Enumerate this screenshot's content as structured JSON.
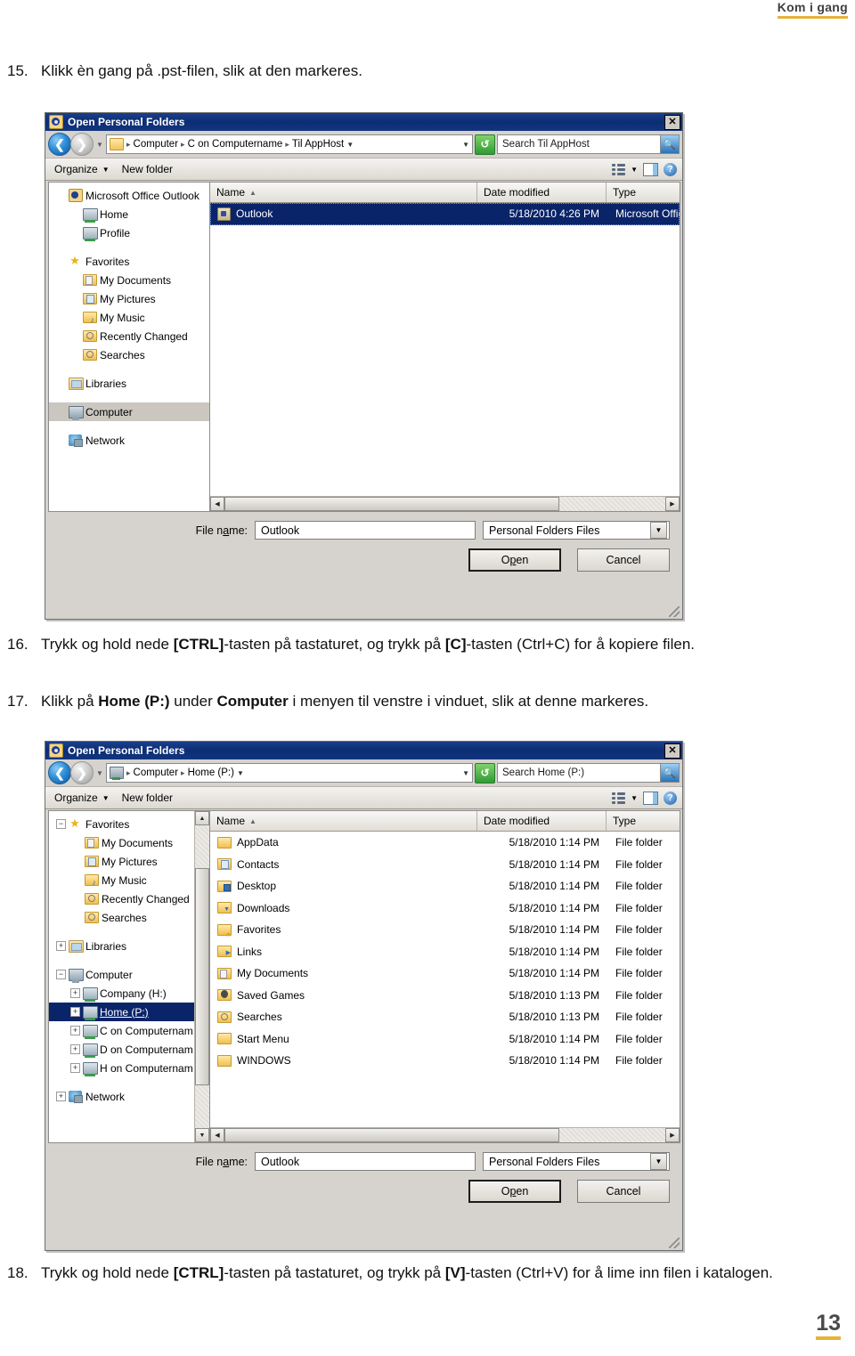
{
  "header": {
    "title": "Kom i gang"
  },
  "page_number": "13",
  "steps": {
    "s15": {
      "num": "15.",
      "text_a": "Klikk èn gang på .pst-filen, slik at den markeres."
    },
    "s16": {
      "num": "16.",
      "text_a": "Trykk og hold nede ",
      "bold_a": "[CTRL]",
      "text_b": "-tasten på tastaturet,  og trykk på ",
      "bold_b": "[C]",
      "text_c": "-tasten (Ctrl+C) for å kopiere filen."
    },
    "s17": {
      "num": "17.",
      "text_a": "Klikk på ",
      "bold_a": "Home (P:)",
      "text_b": " under ",
      "bold_b": "Computer",
      "text_c": " i menyen til venstre i vinduet, slik at denne markeres."
    },
    "s18": {
      "num": "18.",
      "text_a": "Trykk og hold nede ",
      "bold_a": "[CTRL]",
      "text_b": "-tasten på tastaturet,  og trykk på ",
      "bold_b": "[V]",
      "text_c": "-tasten (Ctrl+V) for å lime inn filen i katalogen."
    }
  },
  "dialog1": {
    "title": "Open Personal Folders",
    "title_icon": "outlook-icon",
    "close_label": "✕",
    "nav": {
      "back_icon": "back-arrow-icon",
      "forward_icon": "forward-arrow-icon",
      "history_caret": "▼",
      "breadcrumbs": [
        "Computer",
        "C on Computername",
        "Til AppHost"
      ],
      "crumb_caret": "▼",
      "path_dropdown_caret": "▼",
      "refresh_icon": "refresh-icon",
      "search_value": "Search Til AppHost",
      "search_icon": "search-icon"
    },
    "toolbar": {
      "organize": "Organize",
      "organize_caret": "▼",
      "new_folder": "New folder",
      "views_icon": "views-list-icon",
      "views_caret": "▼",
      "preview_pane_icon": "preview-pane-icon",
      "help_icon": "help-icon",
      "help_glyph": "?"
    },
    "tree": [
      {
        "label": "Microsoft Office Outlook",
        "icon": "outlook-icon",
        "indent": 0,
        "expander": "",
        "state": ""
      },
      {
        "label": "Home",
        "icon": "drive-icon",
        "indent": 1,
        "expander": "",
        "state": ""
      },
      {
        "label": "Profile",
        "icon": "drive-icon",
        "indent": 1,
        "expander": "",
        "state": ""
      },
      {
        "label": "",
        "icon": "",
        "indent": 0,
        "expander": "",
        "state": "spacer"
      },
      {
        "label": "Favorites",
        "icon": "star-icon",
        "indent": 0,
        "expander": "",
        "state": ""
      },
      {
        "label": "My Documents",
        "icon": "folder-documents-icon",
        "indent": 1,
        "expander": "",
        "state": ""
      },
      {
        "label": "My Pictures",
        "icon": "folder-pictures-icon",
        "indent": 1,
        "expander": "",
        "state": ""
      },
      {
        "label": "My Music",
        "icon": "folder-music-icon",
        "indent": 1,
        "expander": "",
        "state": ""
      },
      {
        "label": "Recently Changed",
        "icon": "folder-recent-icon",
        "indent": 1,
        "expander": "",
        "state": ""
      },
      {
        "label": "Searches",
        "icon": "folder-search-icon",
        "indent": 1,
        "expander": "",
        "state": ""
      },
      {
        "label": "",
        "icon": "",
        "indent": 0,
        "expander": "",
        "state": "spacer"
      },
      {
        "label": "Libraries",
        "icon": "library-icon",
        "indent": 0,
        "expander": "",
        "state": ""
      },
      {
        "label": "",
        "icon": "",
        "indent": 0,
        "expander": "",
        "state": "spacer"
      },
      {
        "label": "Computer",
        "icon": "computer-icon",
        "indent": 0,
        "expander": "",
        "state": "selected-gray"
      },
      {
        "label": "",
        "icon": "",
        "indent": 0,
        "expander": "",
        "state": "spacer"
      },
      {
        "label": "Network",
        "icon": "network-icon",
        "indent": 0,
        "expander": "",
        "state": ""
      }
    ],
    "columns": {
      "name": "Name",
      "date": "Date modified",
      "type": "Type",
      "sort_caret": "▲"
    },
    "files": [
      {
        "name": "Outlook",
        "date": "5/18/2010 4:26 PM",
        "type": "Microsoft Office",
        "icon": "pst-file-icon",
        "selected": true
      }
    ],
    "footer": {
      "filename_label_pre": "File n",
      "filename_label_u": "a",
      "filename_label_post": "me:",
      "filename_value": "Outlook",
      "filter_value": "Personal Folders Files",
      "filter_caret": "▼",
      "open_pre": "O",
      "open_u": "p",
      "open_post": "en",
      "cancel": "Cancel"
    }
  },
  "dialog2": {
    "title": "Open Personal Folders",
    "title_icon": "outlook-icon",
    "close_label": "✕",
    "nav": {
      "back_icon": "back-arrow-icon",
      "forward_icon": "forward-arrow-icon",
      "history_caret": "▼",
      "breadcrumbs": [
        "Computer",
        "Home (P:)"
      ],
      "crumb_caret": "▼",
      "path_dropdown_caret": "▼",
      "refresh_icon": "refresh-icon",
      "search_value": "Search Home (P:)",
      "search_icon": "search-icon"
    },
    "toolbar": {
      "organize": "Organize",
      "organize_caret": "▼",
      "new_folder": "New folder",
      "views_icon": "views-list-icon",
      "views_caret": "▼",
      "preview_pane_icon": "preview-pane-icon",
      "help_icon": "help-icon",
      "help_glyph": "?"
    },
    "tree": [
      {
        "label": "Favorites",
        "icon": "star-icon",
        "indent": 0,
        "expander": "−",
        "state": ""
      },
      {
        "label": "My Documents",
        "icon": "folder-documents-icon",
        "indent": 2,
        "expander": "",
        "state": ""
      },
      {
        "label": "My Pictures",
        "icon": "folder-pictures-icon",
        "indent": 2,
        "expander": "",
        "state": ""
      },
      {
        "label": "My Music",
        "icon": "folder-music-icon",
        "indent": 2,
        "expander": "",
        "state": ""
      },
      {
        "label": "Recently Changed",
        "icon": "folder-recent-icon",
        "indent": 2,
        "expander": "",
        "state": ""
      },
      {
        "label": "Searches",
        "icon": "folder-search-icon",
        "indent": 2,
        "expander": "",
        "state": ""
      },
      {
        "label": "",
        "icon": "",
        "indent": 0,
        "expander": "",
        "state": "spacer"
      },
      {
        "label": "Libraries",
        "icon": "library-icon",
        "indent": 0,
        "expander": "+",
        "state": ""
      },
      {
        "label": "",
        "icon": "",
        "indent": 0,
        "expander": "",
        "state": "spacer"
      },
      {
        "label": "Computer",
        "icon": "computer-icon",
        "indent": 0,
        "expander": "−",
        "state": ""
      },
      {
        "label": "Company (H:)",
        "icon": "drive-icon",
        "indent": 1,
        "expander": "+",
        "state": ""
      },
      {
        "label": "Home (P:)",
        "icon": "drive-icon",
        "indent": 1,
        "expander": "+",
        "state": "selected-blue"
      },
      {
        "label": "C on Computernam",
        "icon": "drive-icon",
        "indent": 1,
        "expander": "+",
        "state": ""
      },
      {
        "label": "D on Computernam",
        "icon": "drive-icon",
        "indent": 1,
        "expander": "+",
        "state": ""
      },
      {
        "label": "H on Computernam",
        "icon": "drive-icon",
        "indent": 1,
        "expander": "+",
        "state": ""
      },
      {
        "label": "",
        "icon": "",
        "indent": 0,
        "expander": "",
        "state": "spacer"
      },
      {
        "label": "Network",
        "icon": "network-icon",
        "indent": 0,
        "expander": "+",
        "state": ""
      }
    ],
    "columns": {
      "name": "Name",
      "date": "Date modified",
      "type": "Type",
      "sort_caret": "▲"
    },
    "files": [
      {
        "name": "AppData",
        "date": "5/18/2010 1:14 PM",
        "type": "File folder",
        "icon": "folder-icon",
        "selected": false
      },
      {
        "name": "Contacts",
        "date": "5/18/2010 1:14 PM",
        "type": "File folder",
        "icon": "folder-contacts-icon",
        "selected": false
      },
      {
        "name": "Desktop",
        "date": "5/18/2010 1:14 PM",
        "type": "File folder",
        "icon": "folder-desktop-icon",
        "selected": false
      },
      {
        "name": "Downloads",
        "date": "5/18/2010 1:14 PM",
        "type": "File folder",
        "icon": "folder-downloads-icon",
        "selected": false
      },
      {
        "name": "Favorites",
        "date": "5/18/2010 1:14 PM",
        "type": "File folder",
        "icon": "folder-favorites-icon",
        "selected": false
      },
      {
        "name": "Links",
        "date": "5/18/2010 1:14 PM",
        "type": "File folder",
        "icon": "folder-links-icon",
        "selected": false
      },
      {
        "name": "My Documents",
        "date": "5/18/2010 1:14 PM",
        "type": "File folder",
        "icon": "folder-documents-icon",
        "selected": false
      },
      {
        "name": "Saved Games",
        "date": "5/18/2010 1:13 PM",
        "type": "File folder",
        "icon": "folder-games-icon",
        "selected": false
      },
      {
        "name": "Searches",
        "date": "5/18/2010 1:13 PM",
        "type": "File folder",
        "icon": "folder-search-icon",
        "selected": false
      },
      {
        "name": "Start Menu",
        "date": "5/18/2010 1:14 PM",
        "type": "File folder",
        "icon": "folder-icon",
        "selected": false
      },
      {
        "name": "WINDOWS",
        "date": "5/18/2010 1:14 PM",
        "type": "File folder",
        "icon": "folder-icon",
        "selected": false
      }
    ],
    "footer": {
      "filename_label_pre": "File n",
      "filename_label_u": "a",
      "filename_label_post": "me:",
      "filename_value": "Outlook",
      "filter_value": "Personal Folders Files",
      "filter_caret": "▼",
      "open_pre": "O",
      "open_u": "p",
      "open_post": "en",
      "cancel": "Cancel"
    }
  }
}
